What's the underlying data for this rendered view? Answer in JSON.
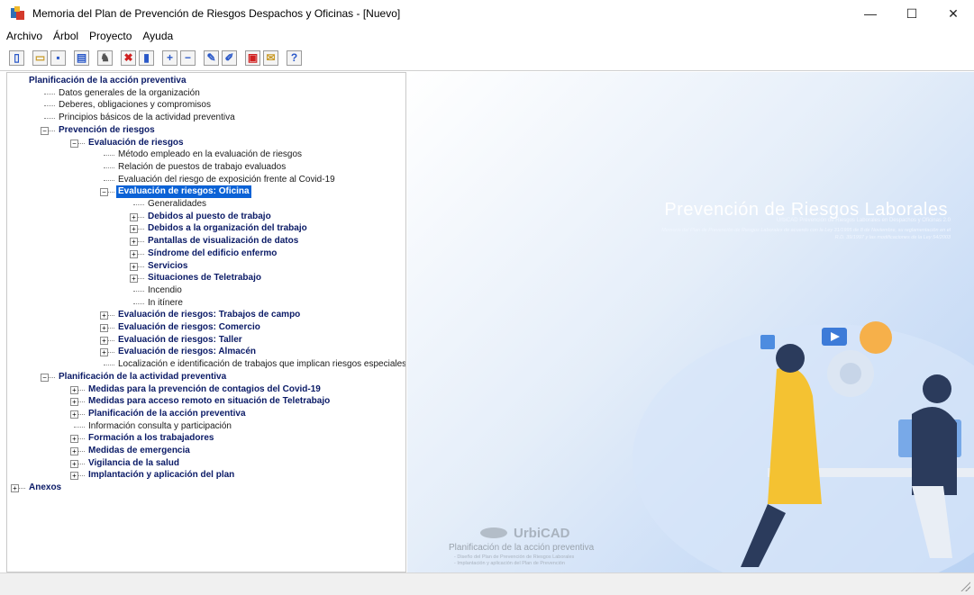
{
  "window": {
    "title": "Memoria del Plan de Prevención de Riesgos Despachos y Oficinas - [Nuevo]",
    "minimize": "—",
    "maximize": "☐",
    "close": "✕"
  },
  "menu": [
    {
      "label": "Archivo"
    },
    {
      "label": "Árbol"
    },
    {
      "label": "Proyecto"
    },
    {
      "label": "Ayuda"
    }
  ],
  "toolbar": [
    {
      "icon": "new-doc-icon",
      "glyph": "▯"
    },
    {
      "icon": "open-folder-icon",
      "glyph": "▭"
    },
    {
      "icon": "save-icon",
      "glyph": "▪"
    },
    {
      "icon": "print-preview-icon",
      "glyph": "▤"
    },
    {
      "icon": "search-icon",
      "glyph": "♞"
    },
    {
      "icon": "delete-icon",
      "glyph": "✖"
    },
    {
      "icon": "cut-icon",
      "glyph": "▮"
    },
    {
      "icon": "expand-icon",
      "glyph": "+"
    },
    {
      "icon": "collapse-icon",
      "glyph": "−"
    },
    {
      "icon": "edit-icon",
      "glyph": "✎"
    },
    {
      "icon": "pencil-icon",
      "glyph": "✐"
    },
    {
      "icon": "report-icon",
      "glyph": "▣"
    },
    {
      "icon": "note-icon",
      "glyph": "✉"
    },
    {
      "icon": "help-icon",
      "glyph": "?"
    }
  ],
  "tree": [
    {
      "label": "Planificación de la acción preventiva",
      "bold": true,
      "depth": 0,
      "expander": null
    },
    {
      "label": "Datos generales de la organización",
      "bold": false,
      "depth": 1,
      "expander": null
    },
    {
      "label": "Deberes, obligaciones y compromisos",
      "bold": false,
      "depth": 1,
      "expander": null
    },
    {
      "label": "Principios básicos de la actividad preventiva",
      "bold": false,
      "depth": 1,
      "expander": null
    },
    {
      "label": "Prevención de riesgos",
      "bold": true,
      "depth": 1,
      "expander": "minus"
    },
    {
      "label": "Evaluación de riesgos",
      "bold": true,
      "depth": 2,
      "expander": "minus"
    },
    {
      "label": "Método empleado en la evaluación de riesgos",
      "bold": false,
      "depth": 3,
      "expander": null
    },
    {
      "label": "Relación de puestos de trabajo evaluados",
      "bold": false,
      "depth": 3,
      "expander": null
    },
    {
      "label": "Evaluación del riesgo de exposición frente al Covid-19",
      "bold": false,
      "depth": 3,
      "expander": null
    },
    {
      "label": "Evaluación de riesgos: Oficina",
      "bold": true,
      "depth": 3,
      "expander": "minus",
      "selected": true
    },
    {
      "label": "Generalidades",
      "bold": false,
      "depth": 4,
      "expander": null
    },
    {
      "label": "Debidos al puesto de trabajo",
      "bold": true,
      "depth": 4,
      "expander": "plus"
    },
    {
      "label": "Debidos a la organización del trabajo",
      "bold": true,
      "depth": 4,
      "expander": "plus"
    },
    {
      "label": "Pantallas de visualización de datos",
      "bold": true,
      "depth": 4,
      "expander": "plus"
    },
    {
      "label": "Síndrome del edificio enfermo",
      "bold": true,
      "depth": 4,
      "expander": "plus"
    },
    {
      "label": "Servicios",
      "bold": true,
      "depth": 4,
      "expander": "plus"
    },
    {
      "label": "Situaciones de Teletrabajo",
      "bold": true,
      "depth": 4,
      "expander": "plus"
    },
    {
      "label": "Incendio",
      "bold": false,
      "depth": 4,
      "expander": null
    },
    {
      "label": "In itínere",
      "bold": false,
      "depth": 4,
      "expander": null
    },
    {
      "label": "Evaluación de riesgos: Trabajos de campo",
      "bold": true,
      "depth": 3,
      "expander": "plus"
    },
    {
      "label": "Evaluación de riesgos: Comercio",
      "bold": true,
      "depth": 3,
      "expander": "plus"
    },
    {
      "label": "Evaluación de riesgos: Taller",
      "bold": true,
      "depth": 3,
      "expander": "plus"
    },
    {
      "label": "Evaluación de riesgos: Almacén",
      "bold": true,
      "depth": 3,
      "expander": "plus"
    },
    {
      "label": "Localización e identificación de trabajos que implican riesgos especiales",
      "bold": false,
      "depth": 3,
      "expander": null
    },
    {
      "label": "Planificación de la actividad preventiva",
      "bold": true,
      "depth": 1,
      "expander": "minus"
    },
    {
      "label": "Medidas para la prevención de contagios del Covid-19",
      "bold": true,
      "depth": 2,
      "expander": "plus"
    },
    {
      "label": "Medidas para acceso remoto en situación de Teletrabajo",
      "bold": true,
      "depth": 2,
      "expander": "plus"
    },
    {
      "label": "Planificación de la acción preventiva",
      "bold": true,
      "depth": 2,
      "expander": "plus"
    },
    {
      "label": "Información consulta y participación",
      "bold": false,
      "depth": 2,
      "expander": null
    },
    {
      "label": "Formación a los trabajadores",
      "bold": true,
      "depth": 2,
      "expander": "plus"
    },
    {
      "label": "Medidas de emergencia",
      "bold": true,
      "depth": 2,
      "expander": "plus"
    },
    {
      "label": "Vigilancia de la salud",
      "bold": true,
      "depth": 2,
      "expander": "plus"
    },
    {
      "label": "Implantación y aplicación del plan",
      "bold": true,
      "depth": 2,
      "expander": "plus"
    },
    {
      "label": "Anexos",
      "bold": true,
      "depth": 0,
      "expander": "plus"
    }
  ],
  "banner": {
    "title": "Prevención de Riesgos Laborales",
    "subtitle": "UrbiCAD Prevención de Riesgos Laborales en Despachos y Oficinas 2.0",
    "description": "Memoria del Plan de Prevención de Riesgos Laborales de acuerdo con la Ley 31/1995 de 8 de Noviembre, su reglamentación en el R.D. 39/1997 y las modificaciones de la Ley 54/2003",
    "logo_text": "UrbiCAD",
    "logo_subtitle": "Planificación de la acción preventiva",
    "logo_line1": "- Diseño del Plan de Prevención de Riesgos Laborales",
    "logo_line2": "- Implantación y aplicación del Plan de Prevención"
  }
}
